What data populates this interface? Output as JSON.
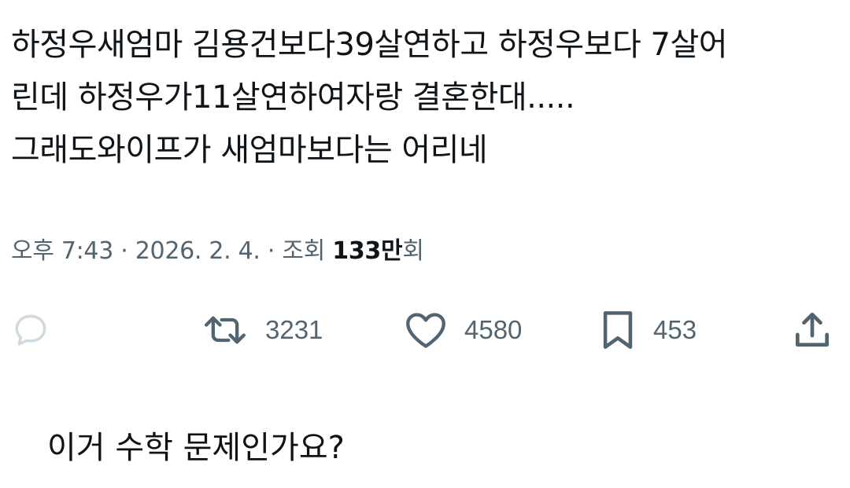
{
  "tweet": {
    "lines": [
      "하정우새엄마 김용건보다39살연하고 하정우보다 7살어",
      "린데 하정우가11살연하여자랑 결혼한대.....",
      "그래도와이프가 새엄마보다는 어리네"
    ]
  },
  "meta": {
    "time": "오후 7:43",
    "separator": "·",
    "date": "2026. 2. 4.",
    "views_label": "조회",
    "views_number": "133만",
    "views_suffix": "회"
  },
  "actions": {
    "retweet_count": "3231",
    "like_count": "4580",
    "bookmark_count": "453"
  },
  "icons": {
    "reply": "reply-icon",
    "retweet": "retweet-icon",
    "like": "heart-icon",
    "bookmark": "bookmark-icon",
    "share": "share-icon"
  },
  "colors": {
    "text": "#0f1419",
    "secondary": "#536471",
    "reply_icon": "#cfd9de"
  },
  "question": "이거 수학 문제인가요?"
}
